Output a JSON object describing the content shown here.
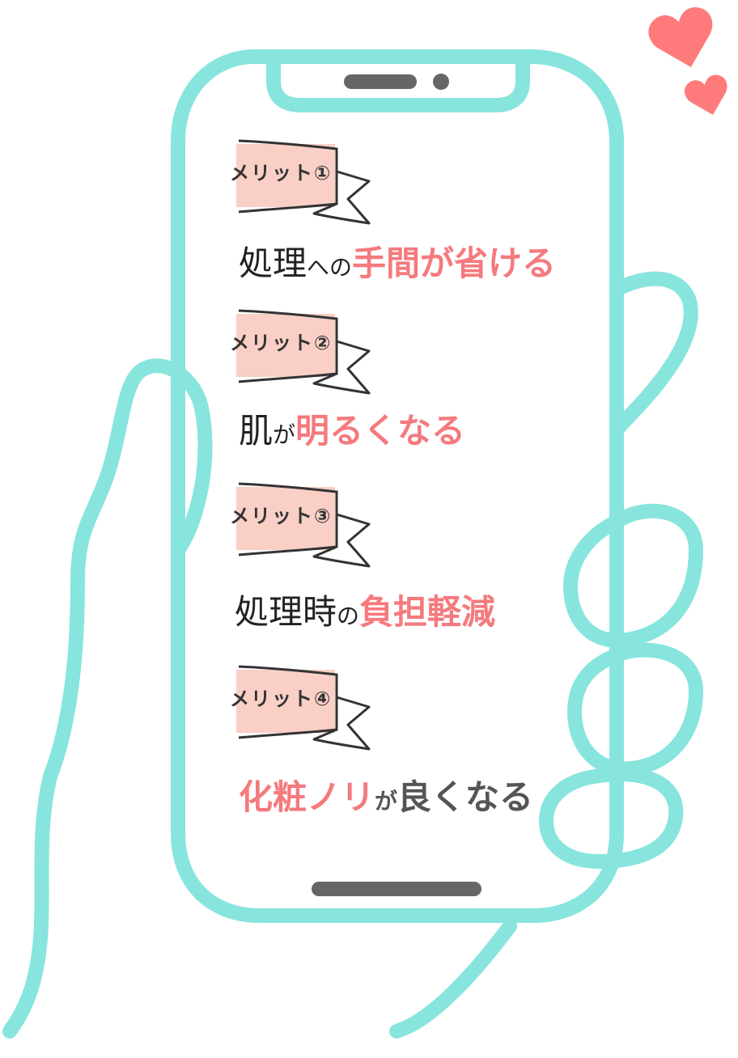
{
  "merits": [
    {
      "label": "メリット①",
      "parts": [
        {
          "text": "処理",
          "style": "black",
          "size": "big"
        },
        {
          "text": "への",
          "style": "black",
          "size": "small"
        },
        {
          "text": "手間が省ける",
          "style": "pink",
          "size": "big"
        }
      ]
    },
    {
      "label": "メリット②",
      "parts": [
        {
          "text": "肌",
          "style": "black",
          "size": "big"
        },
        {
          "text": "が",
          "style": "black",
          "size": "small"
        },
        {
          "text": "明るくなる",
          "style": "pink",
          "size": "big"
        }
      ]
    },
    {
      "label": "メリット③",
      "parts": [
        {
          "text": "処理時",
          "style": "black",
          "size": "big"
        },
        {
          "text": "の",
          "style": "black",
          "size": "small"
        },
        {
          "text": "負担軽減",
          "style": "pink",
          "size": "big"
        }
      ]
    },
    {
      "label": "メリット④",
      "parts": [
        {
          "text": "化粧ノリ",
          "style": "pink",
          "size": "big"
        },
        {
          "text": "が",
          "style": "gray",
          "size": "small"
        },
        {
          "text": "良くなる",
          "style": "gray",
          "size": "big"
        }
      ]
    }
  ],
  "colors": {
    "outline": "#87e5dd",
    "pink": "#f47a7e",
    "ribbon_fill": "#f9cfc6",
    "heart": "#ff7b7b",
    "dark": "#666666"
  },
  "icons": [
    "heart-icon",
    "ribbon-icon"
  ]
}
